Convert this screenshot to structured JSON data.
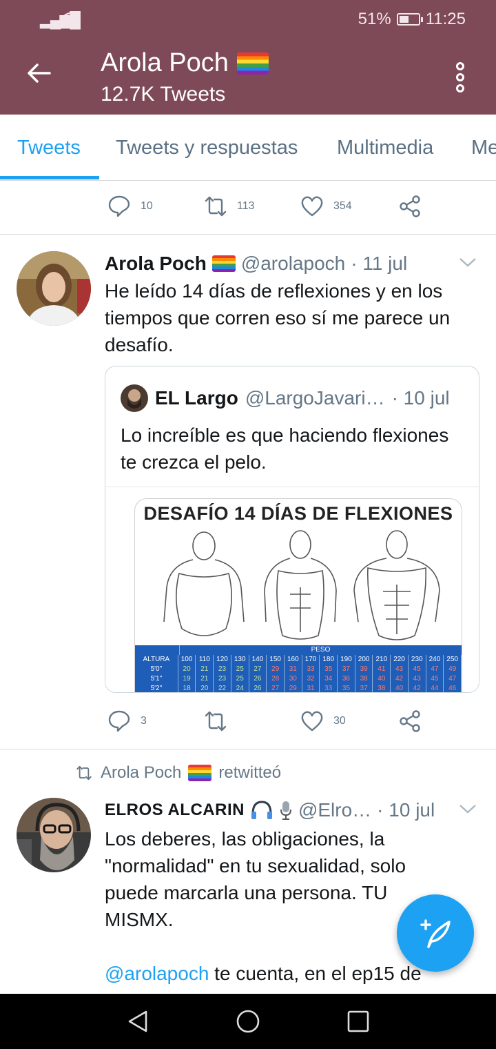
{
  "status_bar": {
    "battery": "51%",
    "time": "11:25",
    "signal_icon": "signal-icon",
    "wifi_icon": "wifi-icon",
    "battery_level": 0.51
  },
  "header": {
    "name": "Arola Poch",
    "flag_icon": "rainbow-flag-icon",
    "subtitle": "12.7K Tweets"
  },
  "tabs": [
    {
      "label": "Tweets",
      "active": true
    },
    {
      "label": "Tweets y respuestas",
      "active": false
    },
    {
      "label": "Multimedia",
      "active": false
    },
    {
      "label": "Me",
      "active": false
    }
  ],
  "prev_tweet_actions": {
    "replies": "10",
    "retweets": "113",
    "likes": "354"
  },
  "tweet1": {
    "name": "Arola Poch",
    "handle": "@arolapoch",
    "date": "· 11 jul",
    "text": "He leído 14 días de reflexiones y en los tiempos que corren eso sí me parece un desafío.",
    "quote": {
      "name": "EL Largo",
      "handle": "@LargoJavari…",
      "date": "· 10 jul",
      "text": "Lo increíble es que haciendo flexiones te crezca el pelo.",
      "media": {
        "title": "DESAFÍO 14 DÍAS DE FLEXIONES",
        "peso_label": "PESO",
        "altura_label": "ALTURA",
        "weights": [
          "100",
          "110",
          "120",
          "130",
          "140",
          "150",
          "160",
          "170",
          "180",
          "190",
          "200",
          "210",
          "220",
          "230",
          "240",
          "250"
        ],
        "rows": [
          {
            "h": "5'0\"",
            "v": [
              "20",
              "21",
              "23",
              "25",
              "27",
              "29",
              "31",
              "33",
              "35",
              "37",
              "39",
              "41",
              "43",
              "45",
              "47",
              "49"
            ]
          },
          {
            "h": "5'1\"",
            "v": [
              "19",
              "21",
              "23",
              "25",
              "26",
              "28",
              "30",
              "32",
              "34",
              "36",
              "38",
              "40",
              "42",
              "43",
              "45",
              "47"
            ]
          },
          {
            "h": "5'2\"",
            "v": [
              "18",
              "20",
              "22",
              "24",
              "26",
              "27",
              "29",
              "31",
              "33",
              "35",
              "37",
              "38",
              "40",
              "42",
              "44",
              "46"
            ]
          }
        ]
      }
    },
    "actions": {
      "replies": "3",
      "retweets": "",
      "likes": "30"
    }
  },
  "retweet_label": {
    "name": "Arola Poch",
    "text": "retwitteó"
  },
  "tweet2": {
    "name": "ELROS ALCARIN",
    "extra_icons": [
      "headphones-icon",
      "microphone-icon"
    ],
    "handle": "@Elro…",
    "date": "· 10 jul",
    "text": "Los deberes, las obligaciones, la \"normalidad\" en tu sexualidad, solo puede marcarla una persona. TU MISMX.",
    "mention": "@arolapoch",
    "text2": " te cuenta, en el ep15 de"
  },
  "colors": {
    "header_bg": "#7e4a57",
    "accent": "#1da1f2"
  }
}
